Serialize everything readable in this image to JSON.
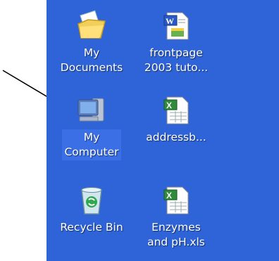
{
  "desktop": {
    "icons": [
      {
        "label": "My\nDocuments",
        "icon": "folder-documents-icon",
        "selected": false
      },
      {
        "label": "frontpage\n2003 tuto...",
        "icon": "word-document-icon",
        "selected": false
      },
      {
        "label": "My\nComputer",
        "icon": "computer-icon",
        "selected": true
      },
      {
        "label": "addressb...",
        "icon": "excel-spreadsheet-icon",
        "selected": false
      },
      {
        "label": "Recycle Bin",
        "icon": "recycle-bin-icon",
        "selected": false
      },
      {
        "label": "Enzymes\nand pH.xls",
        "icon": "excel-spreadsheet-icon",
        "selected": false
      }
    ]
  },
  "colors": {
    "desktop_background": "#2f64d8",
    "selection_highlight": "#3b6fe6",
    "label_text": "#ffffff",
    "arrow": "#000000"
  }
}
